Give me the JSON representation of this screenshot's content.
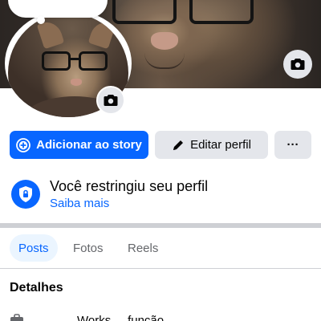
{
  "profile": {
    "cover_camera_icon": "camera-icon",
    "avatar_camera_icon": "camera-icon"
  },
  "actions": {
    "add_story_label": "Adicionar ao story",
    "add_story_icon": "plus-circle-icon",
    "edit_profile_label": "Editar perfil",
    "edit_profile_icon": "pencil-icon",
    "more_label": "···"
  },
  "restriction": {
    "icon": "shield-lock-icon",
    "title": "Você restringiu seu perfil",
    "link": "Saiba mais"
  },
  "tabs": [
    {
      "label": "Posts",
      "active": true
    },
    {
      "label": "Fotos",
      "active": false
    },
    {
      "label": "Reels",
      "active": false
    }
  ],
  "details": {
    "title": "Detalhes",
    "rows": [
      {
        "icon": "briefcase-icon",
        "text": "... ... ...    Works ... função ..."
      }
    ]
  },
  "colors": {
    "primary": "#0866ff",
    "secondary_button": "#e4e6eb",
    "active_tab_bg": "#ebf5ff",
    "muted_text": "#65676b"
  }
}
